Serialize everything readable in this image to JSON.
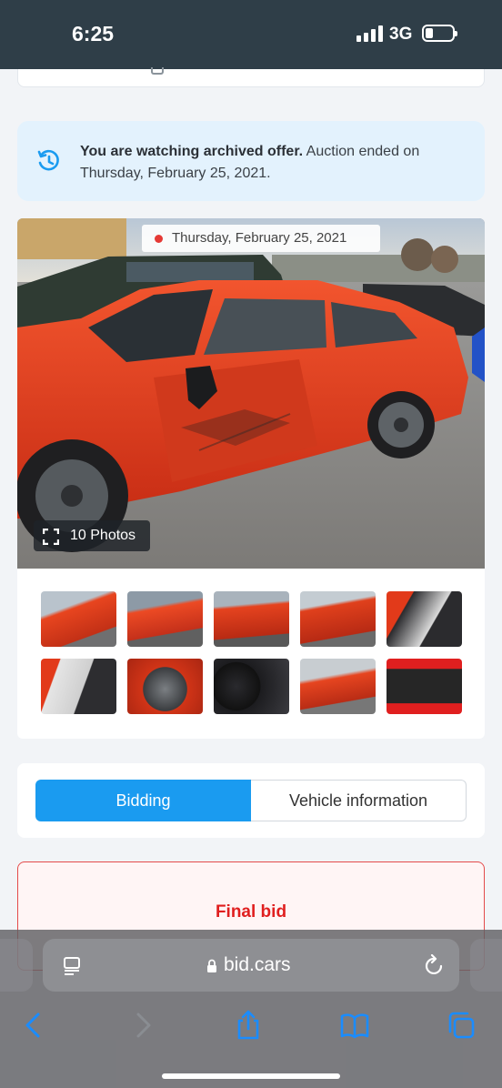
{
  "status_bar": {
    "time": "6:25",
    "network": "3G"
  },
  "archive_banner": {
    "strong_text": "You are watching archived offer.",
    "rest_text": " Auction ended on Thursday, February 25, 2021.",
    "icon": "history-icon"
  },
  "gallery": {
    "date_label": "Thursday, February 25, 2021",
    "photos_label": "10 Photos",
    "thumbnail_count": 10
  },
  "tabs": {
    "bidding": "Bidding",
    "vehicle_info": "Vehicle information",
    "active": "Bidding"
  },
  "final_bid": {
    "label": "Final bid"
  },
  "browser": {
    "url": "bid.cars"
  },
  "colors": {
    "accent": "#1a9bf0",
    "status_bar": "#2f3e48",
    "final_bid_red": "#e01f1f",
    "car_red": "#e6391f"
  }
}
